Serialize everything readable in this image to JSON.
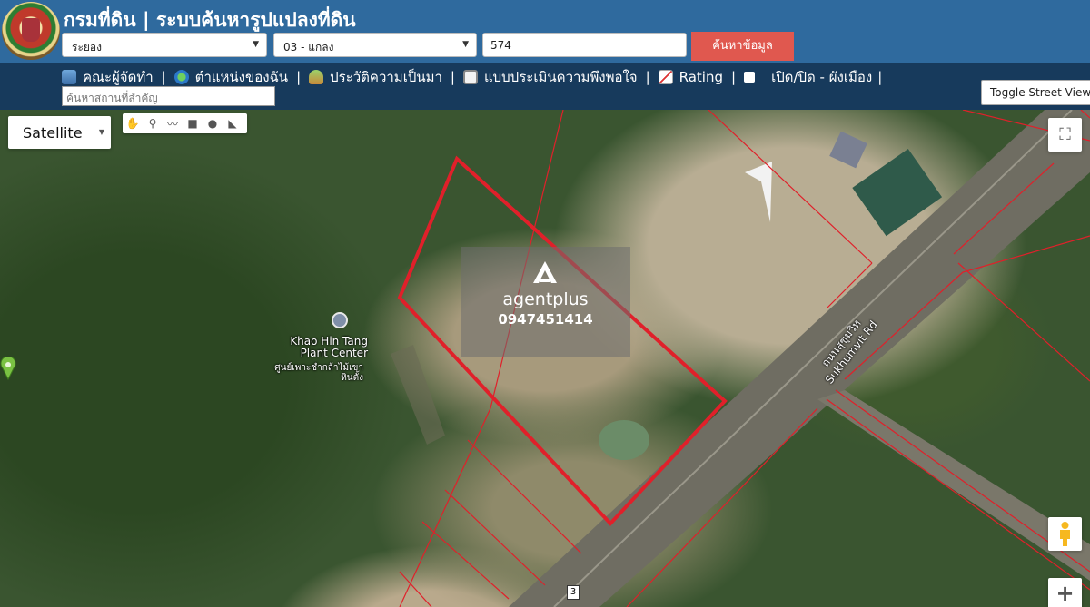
{
  "header": {
    "title": "กรมที่ดิน | ระบบค้นหารูปแปลงที่ดิน",
    "province_select": "ระยอง",
    "district_select": "03 - แกลง",
    "parcel_number": "574",
    "search_button": "ค้นหาข้อมูล"
  },
  "nav": {
    "items": [
      {
        "label": "คณะผู้จัดทำ",
        "icon": "people-icon"
      },
      {
        "label": "ตำแหน่งของฉัน",
        "icon": "globe-icon"
      },
      {
        "label": "ประวัติความเป็นมา",
        "icon": "sprout-icon"
      },
      {
        "label": "แบบประเมินความพึงพอใจ",
        "icon": "note-icon"
      },
      {
        "label": "Rating",
        "icon": "chart-icon"
      },
      {
        "label": "เปิด/ปิด - ผังเมือง",
        "icon": "checkbox"
      }
    ],
    "place_search_placeholder": "ค้นหาสถานที่สำคัญ",
    "toggle_street_view": "Toggle Street View"
  },
  "map": {
    "map_type": "Satellite",
    "draw_tools": [
      "hand-icon",
      "marker-icon",
      "polyline-icon",
      "rectangle-icon",
      "circle-icon",
      "polygon-icon"
    ],
    "watermark": {
      "name": "agentplus",
      "phone": "0947451414"
    },
    "poi": {
      "name": "Khao Hin Tang Plant Center",
      "name_th": "ศูนย์เพาะชำกล้าไม้เขาหินตั้ง"
    },
    "roads": {
      "road_th": "ถนนสุขุมวิท",
      "road_en": "Sukhumvit Rd",
      "route_shield": "3"
    },
    "colors": {
      "parcel_line": "#e0202a",
      "header_bg": "#2f6a9e",
      "nav_bg": "#173a5c",
      "search_btn": "#e0584f"
    }
  }
}
